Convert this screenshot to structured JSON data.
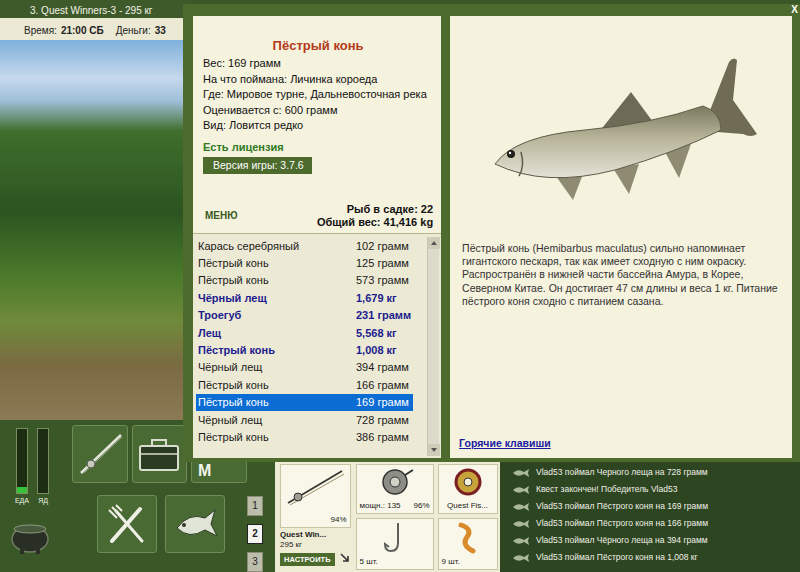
{
  "game": {
    "title": "3. Quest Winners-3 - 295 кг",
    "time_label": "Время:",
    "time": "21:00 СБ",
    "money_label": "Деньги:",
    "money": "33"
  },
  "dialog": {
    "close": "X",
    "fish": {
      "name": "Пёстрый конь",
      "details": [
        "Вес: 169 грамм",
        "На что поймана: Личинка короеда",
        "Где: Мировое турне, Дальневосточная река",
        "Оценивается с: 600 грамм",
        "Вид: Ловится редко"
      ]
    },
    "license": "Есть лицензия",
    "version": "Версия игры: 3.7.6",
    "menu": "МЕНЮ",
    "keepnet": {
      "count": "Рыб в садке: 22",
      "total": "Общий вес: 41,416 kg"
    },
    "catch": [
      {
        "name": "Карась серебряный",
        "weight": "102 грамм",
        "trophy": false,
        "selected": false
      },
      {
        "name": "Пёстрый конь",
        "weight": "125 грамм",
        "trophy": false,
        "selected": false
      },
      {
        "name": "Пёстрый конь",
        "weight": "573 грамм",
        "trophy": false,
        "selected": false
      },
      {
        "name": "Чёрный лещ",
        "weight": "1,679 кг",
        "trophy": true,
        "selected": false
      },
      {
        "name": "Троегуб",
        "weight": "231 грамм",
        "trophy": true,
        "selected": false
      },
      {
        "name": "Лещ",
        "weight": "5,568 кг",
        "trophy": true,
        "selected": false
      },
      {
        "name": "Пёстрый конь",
        "weight": "1,008 кг",
        "trophy": true,
        "selected": false
      },
      {
        "name": "Чёрный лещ",
        "weight": "394 грамм",
        "trophy": false,
        "selected": false
      },
      {
        "name": "Пёстрый конь",
        "weight": "166 грамм",
        "trophy": false,
        "selected": false
      },
      {
        "name": "Пёстрый конь",
        "weight": "169 грамм",
        "trophy": false,
        "selected": true
      },
      {
        "name": "Чёрный лещ",
        "weight": "728 грамм",
        "trophy": false,
        "selected": false
      },
      {
        "name": "Пёстрый конь",
        "weight": "386 грамм",
        "trophy": false,
        "selected": false
      }
    ],
    "description": "Пёстрый конь (Hemibarbus maculatus) сильно напоминает гигантского пескаря, так как имеет сходную с ним окраску. Распространён в нижней части бассейна Амура, в Корее, Северном Китае. Он достигает 47 см длины и веса 1 кг. Питание пёстрого коня сходно с питанием сазана.",
    "hotkeys": "Горячие клавиши"
  },
  "toolbar": {
    "meters": [
      {
        "label": "ЕДА",
        "level": 0.1
      },
      {
        "label": "ЯД",
        "level": 0
      }
    ],
    "menu_key": "M",
    "slots": [
      {
        "label": "1",
        "selected": false
      },
      {
        "label": "2",
        "selected": true
      },
      {
        "label": "3",
        "selected": false
      }
    ]
  },
  "tackle": {
    "rod_name": "Quest Win...",
    "rod_weight": "295 кг",
    "rod_wear": "94%",
    "setup": "НАСТРОИТЬ",
    "reel_power": "мощн.: 135",
    "reel_wear": "96%",
    "line": "Quest Fis...",
    "hooks": "5 шт.",
    "bait": "9 шт."
  },
  "chat": [
    "Vlad53 поймал Черного леща на 728 грамм",
    "Квест закончен! Победитель Vlad53",
    "Vlad53 поймал Пёстрого коня на 169 грамм",
    "Vlad53 поймал Пёстрого коня на 166 грамм",
    "Vlad53 поймал Чёрного леща на 394 грамм",
    "Vlad53 поймал Пёстрого коня на 1,008 кг"
  ]
}
